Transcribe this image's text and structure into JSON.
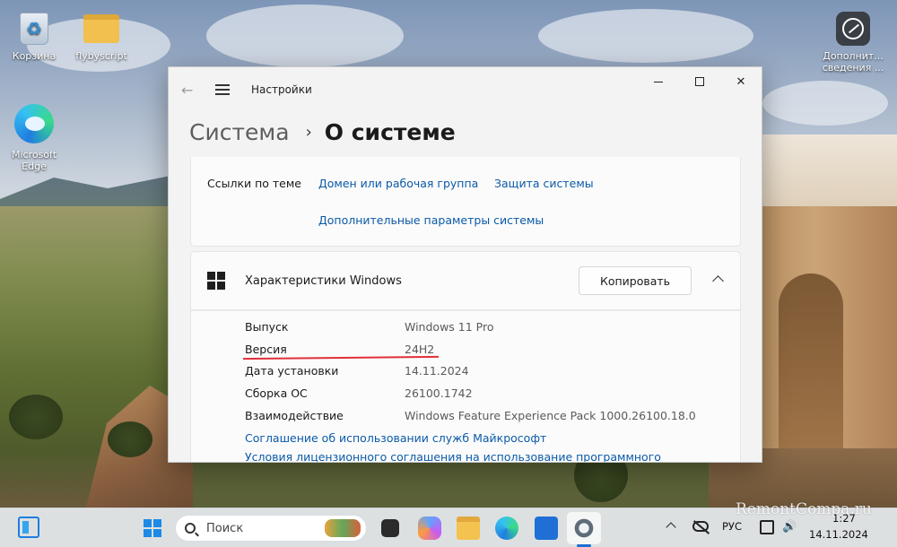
{
  "desktop": {
    "icons": [
      {
        "label": "Корзина"
      },
      {
        "label": "flybyscript"
      },
      {
        "label": "Microsoft Edge"
      },
      {
        "label": "Дополнит... сведения ..."
      }
    ]
  },
  "window": {
    "title": "Настройки",
    "breadcrumb": {
      "parent": "Система",
      "current": "О системе"
    },
    "related_links": {
      "label": "Ссылки по теме",
      "links": [
        "Домен или рабочая группа",
        "Защита системы",
        "Дополнительные параметры системы"
      ]
    },
    "windows_specs": {
      "title": "Характеристики Windows",
      "copy_label": "Копировать",
      "rows": [
        {
          "key": "Выпуск",
          "value": "Windows 11 Pro"
        },
        {
          "key": "Версия",
          "value": "24H2"
        },
        {
          "key": "Дата установки",
          "value": "14.11.2024"
        },
        {
          "key": "Сборка ОС",
          "value": "26100.1742"
        },
        {
          "key": "Взаимодействие",
          "value": "Windows Feature Experience Pack 1000.26100.18.0"
        }
      ],
      "links": [
        "Соглашение об использовании служб Майкрософт",
        "Условия лицензионного соглашения на использование программного"
      ],
      "highlight_color": "#e0303a"
    }
  },
  "taskbar": {
    "search_placeholder": "Поиск",
    "language": "РУС",
    "time": "1:27",
    "date": "14.11.2024"
  },
  "watermark": "RemontCompa.ru",
  "colors": {
    "accent": "#1c6fd0",
    "link": "#0b5aa8"
  }
}
